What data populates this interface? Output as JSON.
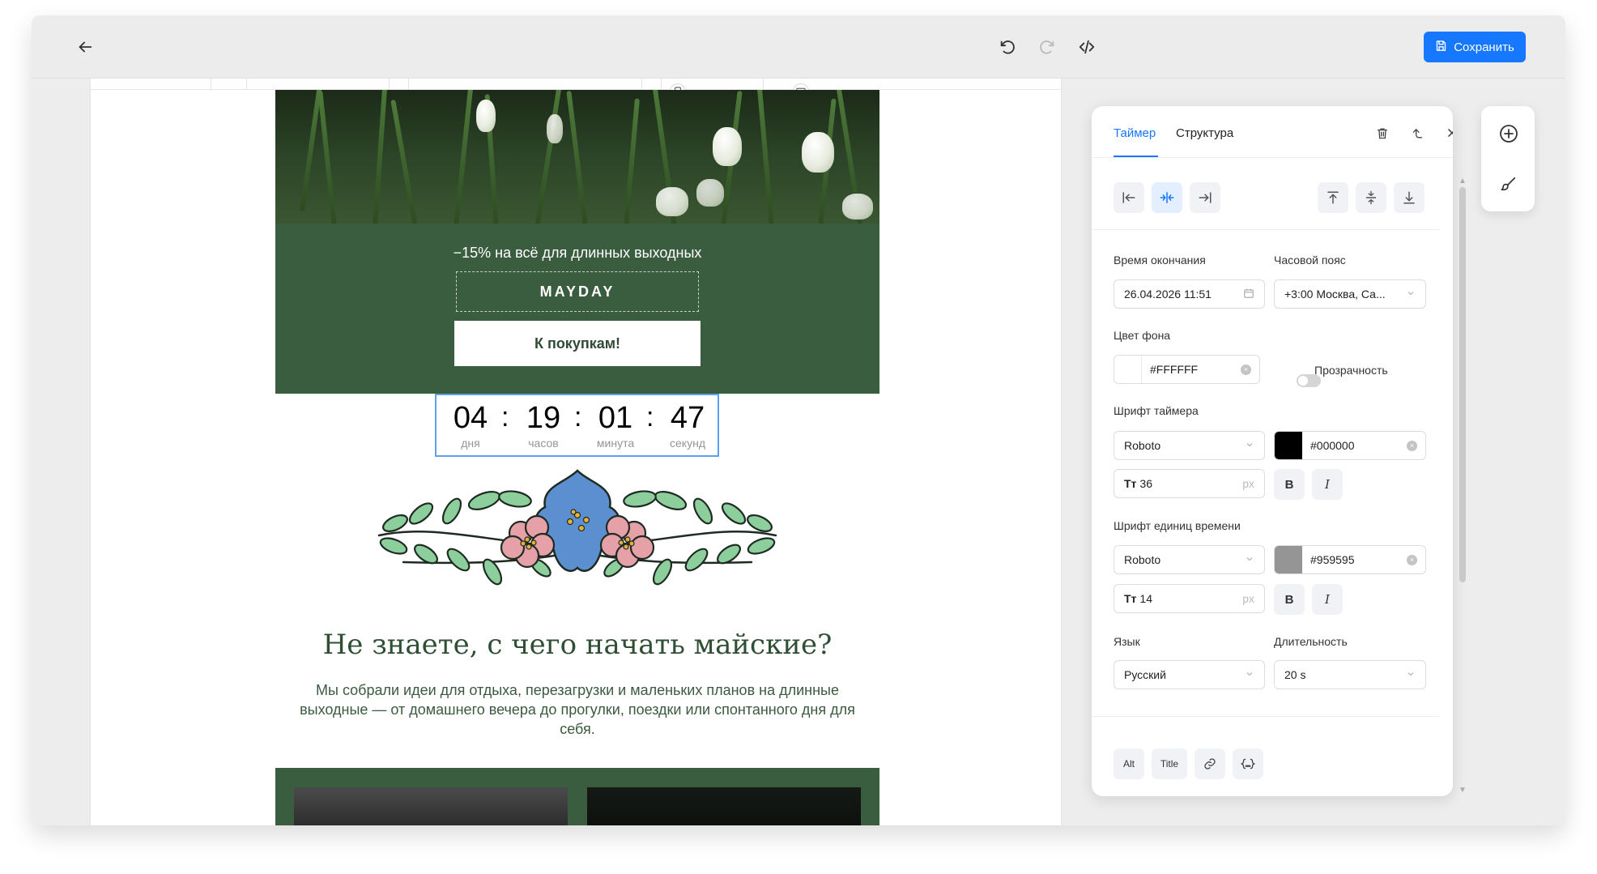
{
  "toolbar": {
    "save_label": "Сохранить",
    "icons": [
      "back-arrow-icon",
      "undo-icon",
      "redo-icon",
      "code-icon",
      "save-icon"
    ]
  },
  "email": {
    "promo_text": "−15% на всё для длинных выходных",
    "promo_code": "MAYDAY",
    "cta_label": "К покупкам!",
    "timer": {
      "days": "04",
      "hours": "19",
      "minutes": "01",
      "seconds": "47",
      "days_label": "дня",
      "hours_label": "часов",
      "minutes_label": "минута",
      "seconds_label": "секунд"
    },
    "heading": "Не знаете, с чего начать майские?",
    "body": "Мы собрали идеи для отдыха, перезагрузки и маленьких планов на длинные выходные — от домашнего вечера до прогулки, поездки или спонтанного дня для себя."
  },
  "panel": {
    "tabs": [
      {
        "label": "Таймер",
        "active": true
      },
      {
        "label": "Структура",
        "active": false
      }
    ],
    "end_time_label": "Время окончания",
    "end_time_value": "26.04.2026 11:51",
    "timezone_label": "Часовой пояс",
    "timezone_value": "+3:00 Москва, Са...",
    "bg_color_label": "Цвет фона",
    "bg_color_value": "#FFFFFF",
    "transparency_label": "Прозрачность",
    "timer_font_label": "Шрифт таймера",
    "timer_font_value": "Roboto",
    "timer_font_color": "#000000",
    "timer_font_size": "36",
    "units_font_label": "Шрифт единиц времени",
    "units_font_value": "Roboto",
    "units_font_color": "#959595",
    "units_font_size": "14",
    "size_prefix": "Tт",
    "size_unit": "px",
    "bold_label": "B",
    "italic_label": "I",
    "language_label": "Язык",
    "language_value": "Русский",
    "duration_label": "Длительность",
    "duration_value": "20 s",
    "alt_label": "Alt",
    "title_label": "Title"
  },
  "colors": {
    "accent": "#1677ff",
    "email_green": "#3a5d3f",
    "timer_border": "#5aa2ef"
  }
}
